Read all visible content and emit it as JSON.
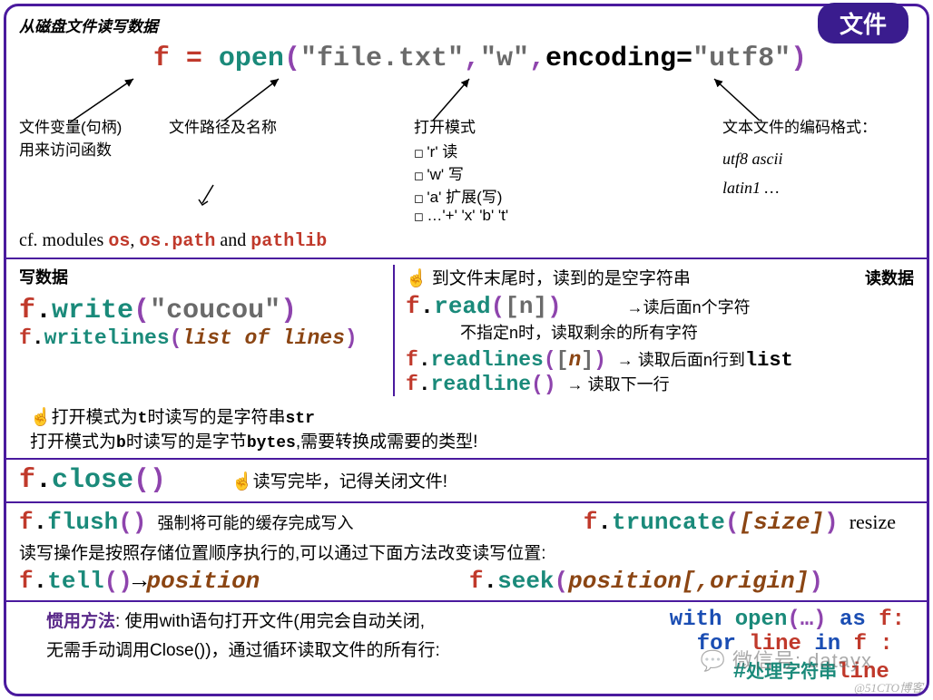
{
  "header": {
    "tag": "文件",
    "subtitle": "从磁盘文件读写数据"
  },
  "open_line": {
    "f": "f",
    "eq": " = ",
    "open": "open",
    "lp": "(",
    "arg1": "\"file.txt\"",
    "c1": ",",
    "arg2": "\"w\"",
    "c2": ",",
    "enc_kw": "encoding=",
    "enc_val": "\"utf8\"",
    "rp": ")"
  },
  "annotations": {
    "file_var": "文件变量(句柄)\n用来访问函数",
    "path": "文件路径及名称",
    "mode_title": "打开模式",
    "modes": [
      "'r' 读",
      "'w' 写",
      "'a' 扩展(写)",
      "…'+' 'x' 'b' 't'"
    ],
    "encoding_title": "文本文件的编码格式：",
    "encodings_1": "utf8  ascii",
    "encodings_2": "latin1  …"
  },
  "cf": {
    "prefix": "cf. modules ",
    "m1": "os",
    "sep1": ", ",
    "m2": "os.path",
    "sep2": " and ",
    "m3": "pathlib"
  },
  "write": {
    "title": "写数据",
    "fn1_arg": "\"coucou\"",
    "fn2_arg": "list of lines"
  },
  "read": {
    "title": "读数据",
    "eof_note": "☝ 到文件末尾时，读到的是空字符串",
    "read_arg": "[n]",
    "read_note1": "→读后面n个字符",
    "read_note2": "不指定n时，读取剩余的所有字符",
    "readlines_arg": "n",
    "readlines_note_a": "→ 读取后面n行到",
    "readlines_note_b": "list",
    "readline_note": "→ 读取下一行"
  },
  "mode_note": {
    "l1a": "☝打开模式为",
    "l1b": "t",
    "l1c": "时读写的是字符串",
    "l1d": "str",
    "l2a": "打开模式为",
    "l2b": "b",
    "l2c": "时读写的是字节",
    "l2d": "bytes",
    "l2e": ",需要转换成需要的类型!"
  },
  "close": {
    "note": "☝读写完毕，记得关闭文件!"
  },
  "flush": {
    "note": "强制将可能的缓存完成写入",
    "trunc_arg": "size",
    "resize": "resize",
    "seek_note": "读写操作是按照存储位置顺序执行的,可以通过下面方法改变读写位置:",
    "tell_ret": "position",
    "seek_arg": "position[,origin]"
  },
  "withblk": {
    "idiom": "惯用方法",
    "txt": ":  使用with语句打开文件(用完会自动关闭,\n无需手动调用Close())，通过循环读取文件的所有行:",
    "code_l1_a": "with ",
    "code_l1_b": "open",
    "code_l1_c": "(…) ",
    "code_l1_d": "as ",
    "code_l1_e": "f:",
    "code_l2_a": "for ",
    "code_l2_b": "line ",
    "code_l2_c": "in ",
    "code_l2_d": "f :",
    "code_l3_a": "#",
    "code_l3_b": "处理字符串",
    "code_l3_c": "line"
  },
  "watermark": "微信号: datayx",
  "watermark2": "@51CTO博客"
}
